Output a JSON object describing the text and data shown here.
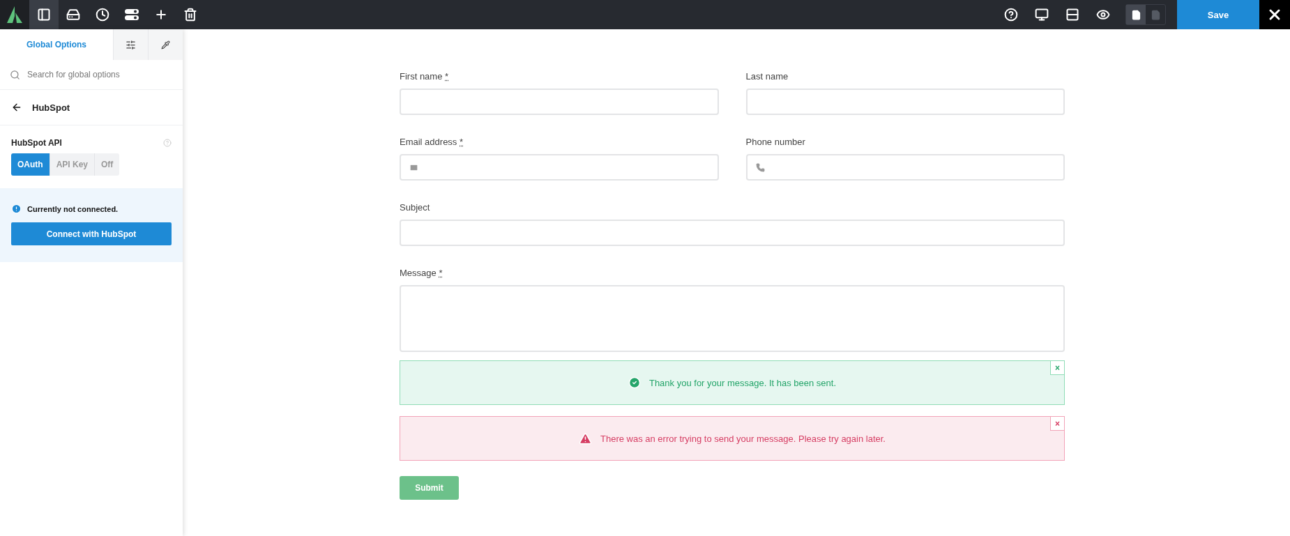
{
  "toolbar": {
    "tools": [
      {
        "selected": true
      },
      {
        "selected": false
      },
      {
        "selected": false
      },
      {
        "selected": false
      },
      {
        "selected": false
      },
      {
        "selected": false
      }
    ],
    "actions": [
      {
        "selected": false
      },
      {
        "selected": false
      },
      {
        "selected": false
      },
      {
        "selected": false
      }
    ],
    "page_toggle": [
      {
        "selected": true
      },
      {
        "selected": false
      }
    ],
    "save_label": "Save"
  },
  "sidebar": {
    "tabs": [
      {
        "label": "Global Options",
        "selected": true
      },
      {
        "selected": false
      },
      {
        "selected": false
      }
    ],
    "search": {
      "placeholder": "Search for global options"
    },
    "section_title": "HubSpot",
    "api_label": "HubSpot API",
    "api_options": [
      {
        "label": "OAuth",
        "selected": true
      },
      {
        "label": "API Key",
        "selected": false
      },
      {
        "label": "Off",
        "selected": false
      }
    ],
    "notice": "Currently not connected.",
    "connect_button": "Connect with HubSpot"
  },
  "form": {
    "fields": [
      {
        "kind": "text",
        "label": "First name",
        "required_mark": "*"
      },
      {
        "kind": "text",
        "label": "Last name"
      },
      {
        "kind": "email",
        "label": "Email address",
        "required_mark": "*"
      },
      {
        "kind": "phone",
        "label": "Phone number"
      },
      {
        "kind": "text",
        "label": "Subject",
        "wide": true
      },
      {
        "kind": "textarea",
        "label": "Message",
        "required_mark": "*",
        "wide": true
      }
    ],
    "alerts": [
      {
        "kind": "success",
        "text": "Thank you for your message. It has been sent.",
        "close": "×"
      },
      {
        "kind": "error",
        "text": "There was an error trying to send your message. Please try again later.",
        "close": "×"
      }
    ],
    "submit": "Submit"
  }
}
